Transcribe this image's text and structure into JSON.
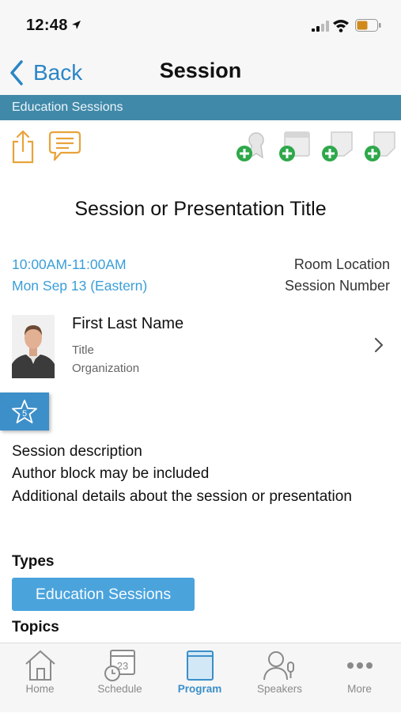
{
  "status_bar": {
    "time": "12:48"
  },
  "nav": {
    "back_label": "Back",
    "title": "Session"
  },
  "section_label": "Education Sessions",
  "session": {
    "title": "Session or Presentation Title",
    "time_range": "10:00AM-11:00AM",
    "date": "Mon Sep 13 (Eastern)",
    "room_location": "Room Location",
    "session_number": "Session Number"
  },
  "speaker": {
    "name": "First Last Name",
    "title": "Title",
    "organization": "Organization"
  },
  "rating": {
    "value": "5"
  },
  "description": [
    "Session description",
    "Author block may be included",
    "Additional details about the session or presentation"
  ],
  "types": {
    "label": "Types",
    "items": [
      "Education Sessions"
    ]
  },
  "topics": {
    "label": "Topics"
  },
  "tabs": [
    {
      "label": "Home",
      "icon": "home-icon"
    },
    {
      "label": "Schedule",
      "icon": "calendar-icon",
      "badge": "23"
    },
    {
      "label": "Program",
      "icon": "book-icon",
      "active": true
    },
    {
      "label": "Speakers",
      "icon": "speaker-icon"
    },
    {
      "label": "More",
      "icon": "ellipsis-icon"
    }
  ],
  "colors": {
    "accent_blue": "#3a9ed8",
    "section_strip": "#4189a8",
    "toolbar_orange": "#e8a33a",
    "add_green": "#2ea84a",
    "pill_blue": "#4ba3dc"
  }
}
